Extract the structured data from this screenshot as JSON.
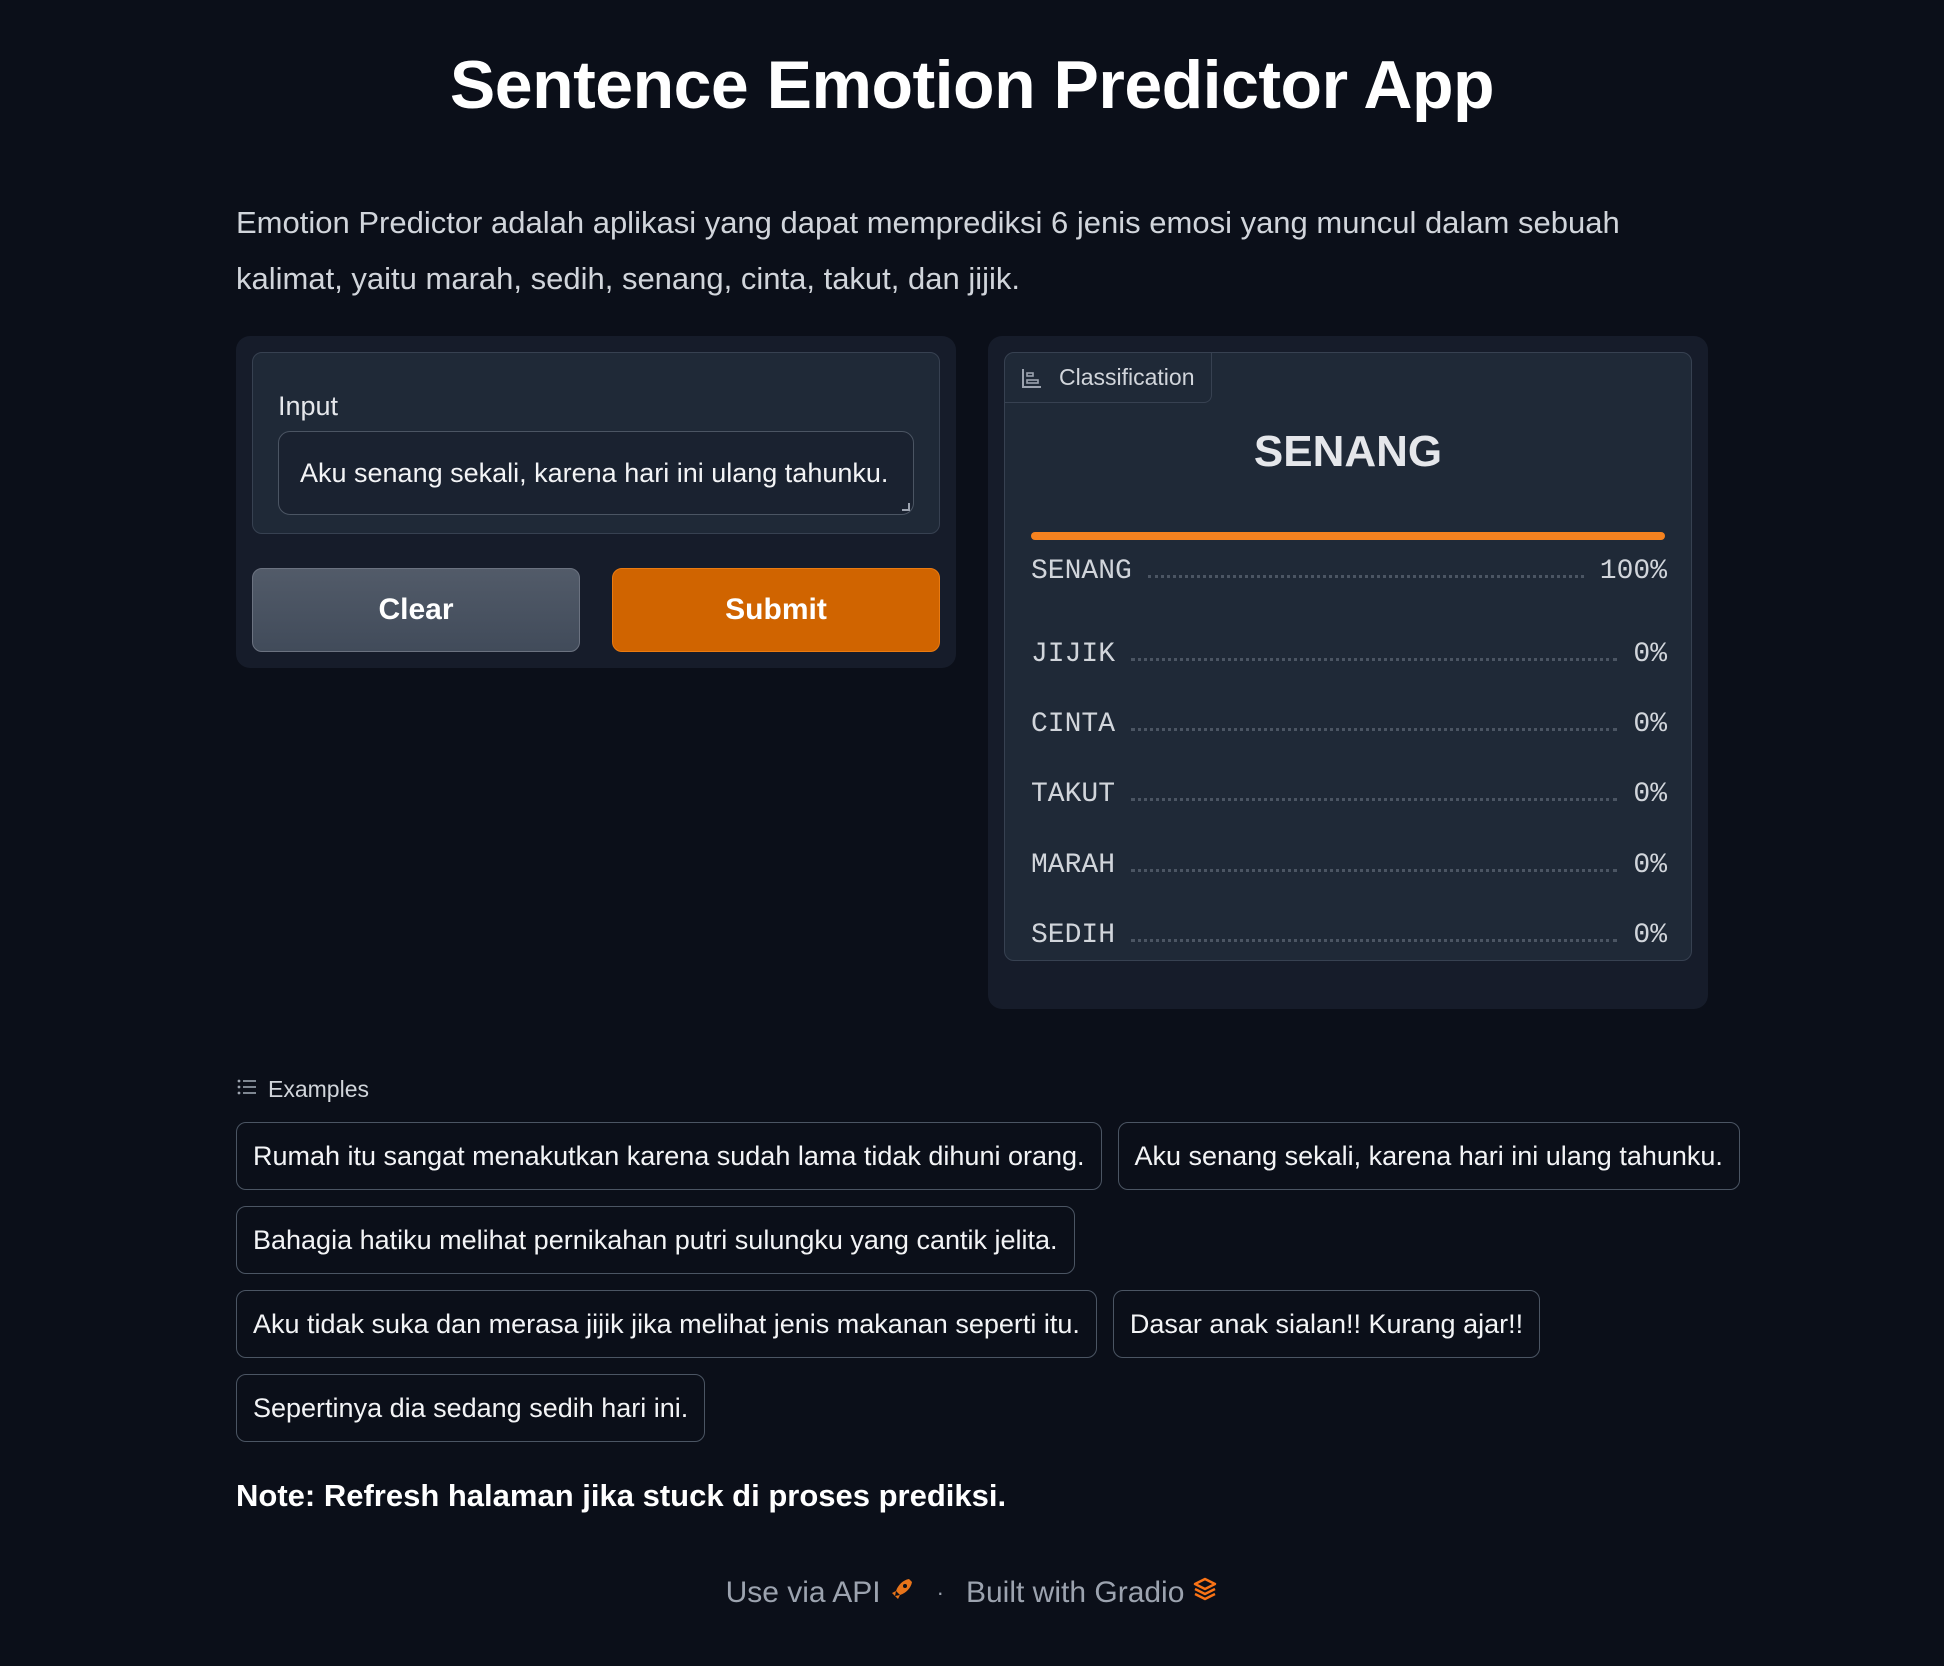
{
  "header": {
    "title": "Sentence Emotion Predictor App",
    "description": "Emotion Predictor adalah aplikasi yang dapat memprediksi 6 jenis emosi yang muncul dalam sebuah kalimat, yaitu marah, sedih, senang, cinta, takut, dan jijik."
  },
  "input": {
    "label": "Input",
    "value": "Aku senang sekali, karena hari ini ulang tahunku."
  },
  "buttons": {
    "clear": "Clear",
    "submit": "Submit"
  },
  "classification": {
    "tab_label": "Classification",
    "top_label": "SENANG",
    "confidences": [
      {
        "label": "SENANG",
        "pct": "100%",
        "value": 1.0
      },
      {
        "label": "JIJIK",
        "pct": "0%",
        "value": 0.0
      },
      {
        "label": "CINTA",
        "pct": "0%",
        "value": 0.0
      },
      {
        "label": "TAKUT",
        "pct": "0%",
        "value": 0.0
      },
      {
        "label": "MARAH",
        "pct": "0%",
        "value": 0.0
      },
      {
        "label": "SEDIH",
        "pct": "0%",
        "value": 0.0
      }
    ]
  },
  "examples": {
    "heading": "Examples",
    "items": [
      "Rumah itu sangat menakutkan karena sudah lama tidak dihuni orang.",
      "Aku senang sekali, karena hari ini ulang tahunku.",
      "Bahagia hatiku melihat pernikahan putri sulungku yang cantik jelita.",
      "Aku tidak suka dan merasa jijik jika melihat jenis makanan seperti itu.",
      "Dasar anak sialan!! Kurang ajar!!",
      "Sepertinya dia sedang sedih hari ini."
    ]
  },
  "note": "Note: Refresh halaman jika stuck di proses prediksi.",
  "footer": {
    "api_label": "Use via API",
    "separator": "·",
    "built_label": "Built with Gradio"
  },
  "colors": {
    "accent": "#d06400",
    "bar": "#f5821f",
    "background": "#0b0f19"
  }
}
